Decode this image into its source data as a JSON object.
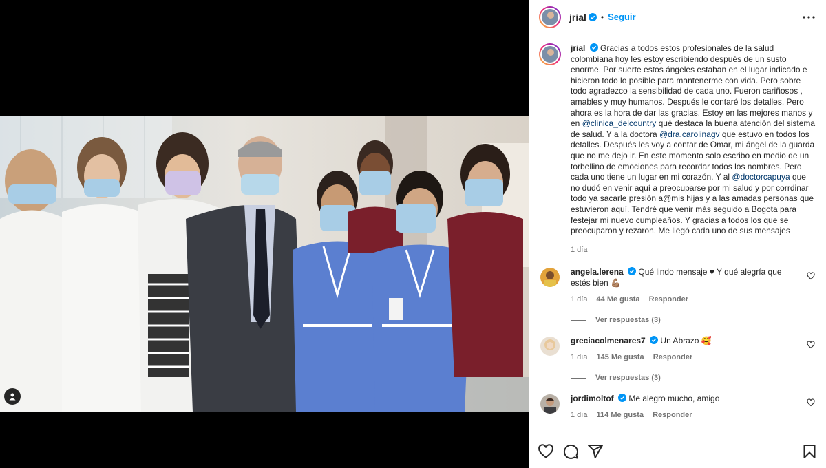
{
  "post": {
    "username": "jrial",
    "follow_label": "Seguir",
    "separator": "•",
    "caption_text": "Gracias a todos estos profesionales de la salud colombiana hoy les estoy escribiendo después de un susto enorme. Por suerte estos ángeles estaban en el lugar indicado e hicieron todo lo posible para mantenerme con vida. Pero sobre todo agradezco la sensibilidad de cada uno. Fueron cariñosos , amables y muy humanos. Después le contaré los detalles. Pero ahora es la hora de dar las gracias. Estoy en las mejores manos y en ",
    "mention1": "@clinica_delcountry",
    "caption_text2": " qué destaca la buena atención del sistema de salud. Y a la doctora ",
    "mention2": "@dra.carolinagv",
    "caption_text3": " que estuvo en todos los detalles. Después les voy a contar de Omar, mi ángel de la guarda que no me dejo ir. En este momento solo escribo en medio de un torbellino de emociones para recordar todos los nombres. Pero cada uno tiene un lugar en mi corazón. Y al ",
    "mention3": "@doctorcapuya",
    "caption_text4": " que no dudó en venir aquí a preocuparse por mi salud y por corrdinar todo ya sacarle presión a@mis hijas y a las amadas personas que estuvieron aquí. Tendré que venir más seguido a Bogota para festejar mi nuevo cumpleaños. Y gracias a todos los que se preocuparon y rezaron. Me llegó cada uno de sus mensajes",
    "time": "1 día"
  },
  "comments": [
    {
      "username": "angela.lerena",
      "text": "Qué lindo mensaje ♥ Y qué alegría que estés bien 💪🏽",
      "time": "1 día",
      "likes": "44 Me gusta",
      "reply": "Responder",
      "view_replies": "Ver respuestas (3)"
    },
    {
      "username": "greciacolmenares7",
      "text": "Un Abrazo 🥰",
      "time": "1 día",
      "likes": "145 Me gusta",
      "reply": "Responder",
      "view_replies": "Ver respuestas (3)"
    },
    {
      "username": "jordimoltof",
      "text": "Me alegro mucho, amigo",
      "time": "1 día",
      "likes": "114 Me gusta",
      "reply": "Responder"
    }
  ],
  "colors": {
    "accent": "#0095f6",
    "verified": "#0095f6",
    "scrubs_blue": "#5b7fd0",
    "scrubs_maroon": "#7a1f2b"
  },
  "icons": [
    "tag-user-icon",
    "more-options-icon",
    "verified-icon",
    "heart-icon",
    "comment-icon",
    "share-icon",
    "save-icon"
  ]
}
